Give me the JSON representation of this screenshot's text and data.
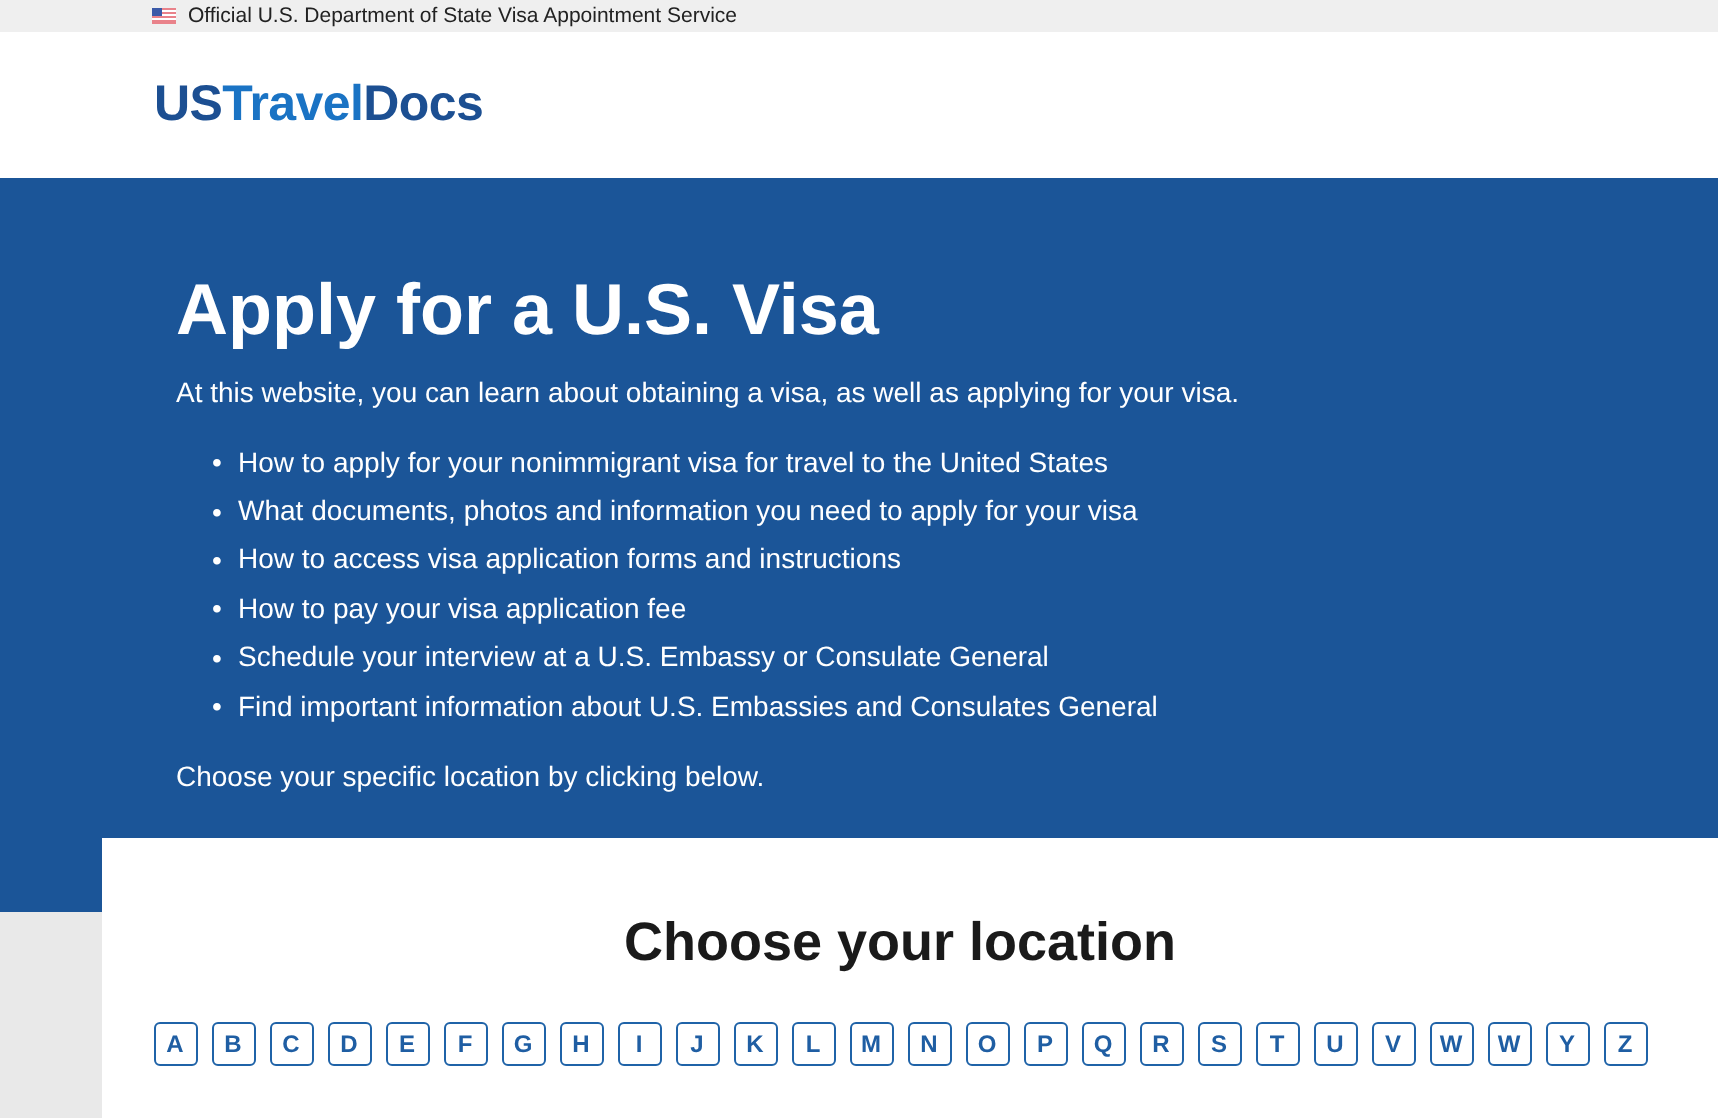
{
  "top_bar": {
    "text": "Official U.S. Department of State Visa Appointment Service"
  },
  "logo": {
    "parts": [
      "US",
      "Travel",
      "Docs"
    ]
  },
  "hero": {
    "title": "Apply for a U.S. Visa",
    "intro": "At this website, you can learn about obtaining a visa, as well as applying for your visa.",
    "bullet": "•",
    "items": [
      "How to apply for your nonimmigrant visa for travel to the United States",
      "What documents, photos and information you need to apply for your visa",
      "How to access visa application forms and instructions",
      "How to pay your visa application fee",
      "Schedule your interview at a U.S. Embassy or Consulate General",
      "Find important information about U.S. Embassies and Consulates General"
    ],
    "footer": "Choose your specific location by clicking below."
  },
  "location": {
    "title": "Choose your location",
    "letters": [
      "A",
      "B",
      "C",
      "D",
      "E",
      "F",
      "G",
      "H",
      "I",
      "J",
      "K",
      "L",
      "M",
      "N",
      "O",
      "P",
      "Q",
      "R",
      "S",
      "T",
      "U",
      "V",
      "W",
      "W",
      "Y",
      "Z"
    ]
  }
}
